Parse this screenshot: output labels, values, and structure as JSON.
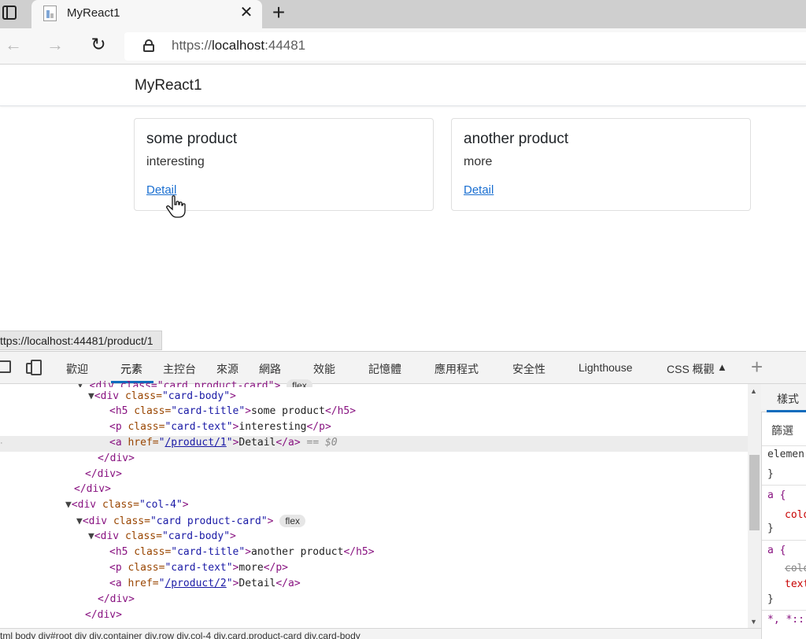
{
  "browser": {
    "tab_title": "MyReact1",
    "url_scheme": "https://",
    "url_host": "localhost",
    "url_port": ":44481",
    "status_url": "ttps://localhost:44481/product/1"
  },
  "app": {
    "brand": "MyReact1",
    "cards": [
      {
        "title": "some product",
        "text": "interesting",
        "link": "Detail"
      },
      {
        "title": "another product",
        "text": "more",
        "link": "Detail"
      }
    ]
  },
  "devtools": {
    "tabs": [
      "歡迎",
      "元素",
      "主控台",
      "來源",
      "網路",
      "效能",
      "記憶體",
      "應用程式",
      "安全性",
      "Lighthouse",
      "CSS 概觀"
    ],
    "active_tab": "元素",
    "dom": {
      "l0": "<div class=\"card product-card\">",
      "l0_pill": "flex",
      "l1_tag": "<div",
      "l1_attr": " class=",
      "l1_val": "\"card-body\"",
      "l1_close": ">",
      "l2_open": "<h5",
      "l2_attr": " class=",
      "l2_val": "\"card-title\"",
      "l2_gt": ">",
      "l2_text": "some product",
      "l2_close": "</h5>",
      "l3_open": "<p",
      "l3_attr": " class=",
      "l3_val": "\"card-text\"",
      "l3_gt": ">",
      "l3_text": "interesting",
      "l3_close": "</p>",
      "l4_open": "<a",
      "l4_attr": " href=",
      "l4_q1": "\"",
      "l4_link": "/product/1",
      "l4_q2": "\"",
      "l4_gt": ">",
      "l4_text": "Detail",
      "l4_close": "</a>",
      "l4_eq": "== $0",
      "l5": "</div>",
      "l6": "</div>",
      "l7": "</div>",
      "l8_open": "<div",
      "l8_attr": " class=",
      "l8_val": "\"col-4\"",
      "l8_gt": ">",
      "l9_open": "<div",
      "l9_attr": " class=",
      "l9_val": "\"card product-card\"",
      "l9_gt": ">",
      "l9_pill": "flex",
      "l10_open": "<div",
      "l10_attr": " class=",
      "l10_val": "\"card-body\"",
      "l10_gt": ">",
      "l11_open": "<h5",
      "l11_attr": " class=",
      "l11_val": "\"card-title\"",
      "l11_gt": ">",
      "l11_text": "another product",
      "l11_close": "</h5>",
      "l12_open": "<p",
      "l12_attr": " class=",
      "l12_val": "\"card-text\"",
      "l12_gt": ">",
      "l12_text": "more",
      "l12_close": "</p>",
      "l13_open": "<a",
      "l13_attr": " href=",
      "l13_q1": "\"",
      "l13_link": "/product/2",
      "l13_q2": "\"",
      "l13_gt": ">",
      "l13_text": "Detail",
      "l13_close": "</a>",
      "l14": "</div>",
      "l15": "</div>"
    },
    "breadcrumb": "tml   body   div#root   div   div.container   div.row   div.col-4   div.card.product-card   div.card-body",
    "styles": {
      "tab": "樣式",
      "filter": "篩選",
      "element": "elemen",
      "brace_close": "}",
      "rule_a": "a {",
      "prop_color": "colo",
      "prop_color_struck": "colo",
      "prop_text": "text",
      "rule_star": "*, *::"
    }
  },
  "colors": {
    "accent": "#0f6cbd",
    "link": "#1a6fd1"
  }
}
